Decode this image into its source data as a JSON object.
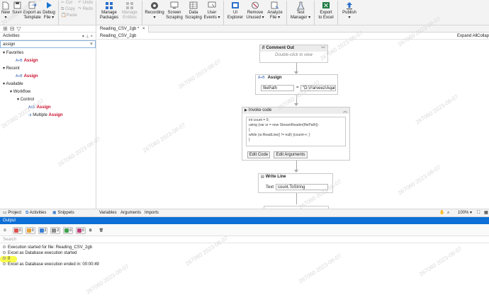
{
  "ribbon": {
    "new_line1": "New",
    "new_line2": "▾",
    "save": "Save",
    "export_template_line1": "Export as",
    "export_template_line2": "Template",
    "debug_file_line1": "Debug",
    "debug_file_line2": "File ▾",
    "cut": "Cut",
    "copy": "Copy",
    "paste": "Paste",
    "undo": "Undo",
    "redo": "Redo",
    "manage_packages_line1": "Manage",
    "manage_packages_line2": "Packages",
    "manage_entities_line1": "Manage",
    "manage_entities_line2": "Entities",
    "recording_line1": "Recording",
    "recording_line2": "▾",
    "screen_scraping_line1": "Screen",
    "screen_scraping_line2": "Scraping",
    "data_scraping_line1": "Data",
    "data_scraping_line2": "Scraping",
    "user_events_line1": "User",
    "user_events_line2": "Events ▾",
    "ui_explorer_line1": "UI",
    "ui_explorer_line2": "Explorer",
    "remove_unused_line1": "Remove",
    "remove_unused_line2": "Unused ▾",
    "analyze_file_line1": "Analyze",
    "analyze_file_line2": "File ▾",
    "test_manager_line1": "Test",
    "test_manager_line2": "Manager ▾",
    "export_excel_line1": "Export",
    "export_excel_line2": "to Excel",
    "publish_line1": "Publish",
    "publish_line2": "▾"
  },
  "activities_panel": {
    "title": "Activities",
    "search_value": "assign",
    "nodes": {
      "favorites": "Favorites",
      "fav_assign": "Assign",
      "recent": "Recent",
      "recent_assign": "Assign",
      "available": "Available",
      "workflow": "Workflow",
      "control": "Control",
      "control_assign": "Assign",
      "multiple_prefix": "Multiple ",
      "multiple_assign": "Assign"
    }
  },
  "designer": {
    "tab_label": "Reading_CSV_2gb *",
    "breadcrumb": "Reading_CSV_2gb",
    "expand_all": "Expand All",
    "collapse_all": "Collap",
    "comment_out": {
      "title": "Comment Out",
      "hint": "Double-click to view"
    },
    "assign": {
      "title": "Assign",
      "to": "filePath",
      "eq": "=",
      "value": "\"D:\\Parveez\\Aqam"
    },
    "invoke_code": {
      "title": "Invoke code",
      "code_line1": "int count = 0;",
      "code_line2": "using (var sr = new StreamReader(filePath))",
      "code_line3": "{",
      "code_line4": "  while (sr.ReadLine() != null) {count++; }",
      "code_line5": "}",
      "edit_code": "Edit Code",
      "edit_arguments": "Edit Arguments"
    },
    "write_line": {
      "title": "Write Line",
      "text_label": "Text",
      "text_value": "count.ToString"
    }
  },
  "bottom_tabs": {
    "project": "Project",
    "activities": "Activities",
    "snippets": "Snippets",
    "variables": "Variables",
    "arguments": "Arguments",
    "imports": "Imports",
    "zoom": "100%"
  },
  "output": {
    "title": "Output",
    "filters": {
      "errors": "0",
      "warnings": "0",
      "info": "2",
      "trace": "2",
      "verbose": "0",
      "debug": "0"
    },
    "search_placeholder": "Search",
    "logs": [
      "Execution started for file: Reading_CSV_2gb",
      "Excel as Database execution started",
      "0",
      "Excel as Database execution ended in: 00:00:49"
    ]
  },
  "watermark_text": "267060 2023-08-07",
  "colors": {
    "accent": "#0e6fd6",
    "activity_name": "#c8102e",
    "highlight": "#f8fb3a"
  }
}
